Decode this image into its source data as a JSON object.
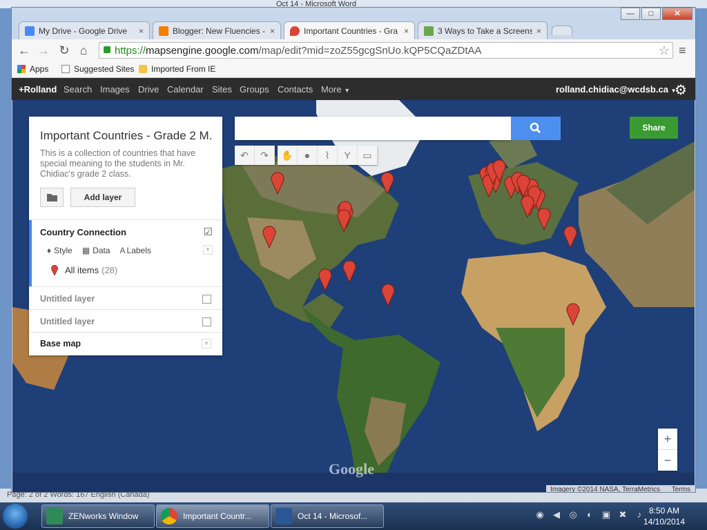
{
  "word_window": {
    "title": "Oct 14 - Microsoft Word",
    "status": "Page: 2 of 2   Words: 167   English (Canada)"
  },
  "tabs": [
    {
      "label": "My Drive - Google Drive",
      "color": "#4a8af4"
    },
    {
      "label": "Blogger: New Fluencies - E",
      "color": "#f57d00"
    },
    {
      "label": "Important Countries - Gra",
      "color": "#db4437"
    },
    {
      "label": "3 Ways to Take a Screensh",
      "color": "#6aa84f"
    }
  ],
  "window_controls": {
    "minimize": "—",
    "maximize": "□",
    "close": "✕"
  },
  "omnibox": {
    "scheme": "https://",
    "host": "mapsengine.google.com",
    "path": "/map/edit?mid=zoZ55gcgSnUo.kQP5CQaZDtAA"
  },
  "bookmarks": [
    {
      "label": "Apps",
      "icon": "apps-grid-icon"
    },
    {
      "label": "Suggested Sites",
      "icon": "page-icon"
    },
    {
      "label": "Imported From IE",
      "icon": "folder-icon"
    }
  ],
  "google_bar": {
    "items": [
      "+Rolland",
      "Search",
      "Images",
      "Drive",
      "Calendar",
      "Sites",
      "Groups",
      "Contacts",
      "More"
    ],
    "account": "rolland.chidiac@wcdsb.ca"
  },
  "panel": {
    "title": "Important Countries - Grade 2 M...",
    "description": "This is a collection of countries that have special meaning to the students in Mr. Chidiac's grade 2 class.",
    "add_layer": "Add layer",
    "layer1": {
      "name": "Country Connection",
      "style": "Style",
      "data": "Data",
      "labels": "Labels",
      "all_items": "All items",
      "count": "(28)"
    },
    "layer2": "Untitled layer",
    "layer3": "Untitled layer",
    "base_map": "Base map"
  },
  "map": {
    "share": "Share",
    "zoom_in": "+",
    "zoom_out": "−",
    "logo": "Google",
    "imagery": "Imagery ©2014 NASA, TerraMetrics",
    "terms": "Terms",
    "accent": "#4d8fef",
    "marker_color": "#db4437"
  },
  "taskbar": {
    "items": [
      "ZENworks Window",
      "Important Countr...",
      "Oct 14 - Microsof..."
    ],
    "time": "8:50 AM",
    "date": "14/10/2014"
  }
}
